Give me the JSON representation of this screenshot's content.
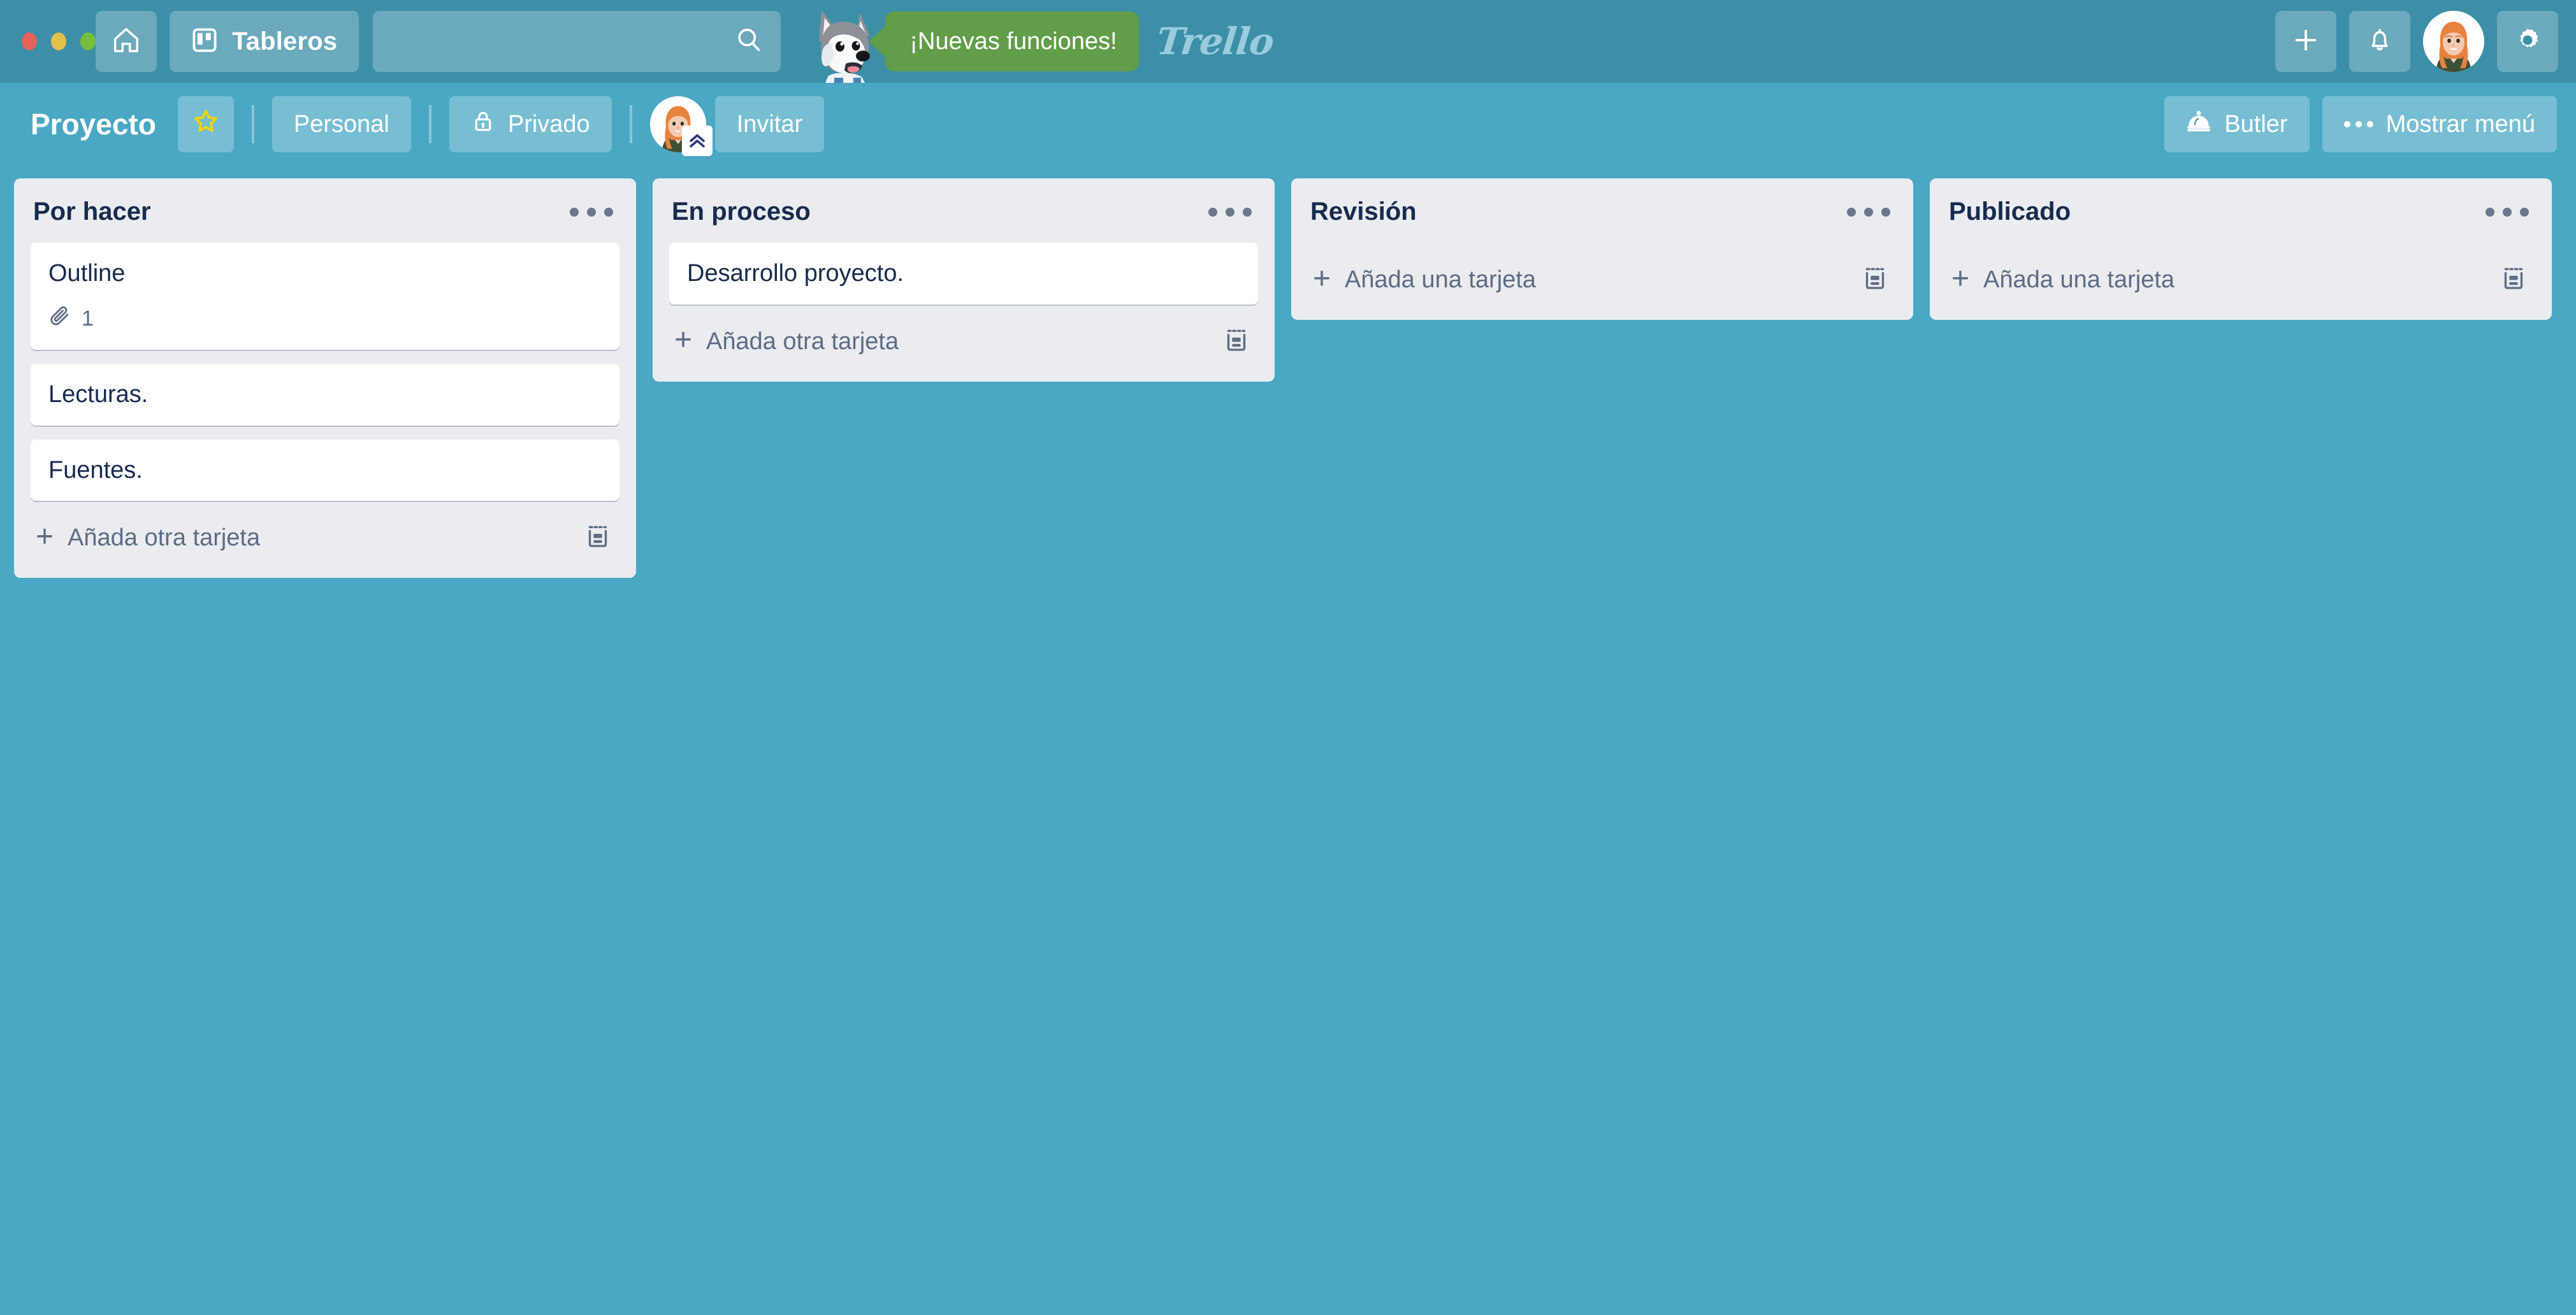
{
  "colors": {
    "top_header_bg": "#3d8fa8",
    "board_bg": "#4aa8c4",
    "list_bg": "#ebecf0",
    "card_bg": "#ffffff",
    "text_dark": "#172b4d",
    "text_muted": "#5e6c84",
    "promo_green": "#629d49",
    "star_yellow": "#f2d600",
    "traffic_red": "#e8615a",
    "traffic_yellow": "#e2c14a",
    "traffic_green": "#76bf3d"
  },
  "window": {
    "traffic_lights": [
      "close-button",
      "minimize-button",
      "maximize-button"
    ]
  },
  "top_header": {
    "home_icon": "home-icon",
    "boards_icon": "boards-icon",
    "boards_label": "Tableros",
    "search": {
      "value": "",
      "placeholder": "",
      "icon": "search-icon"
    },
    "mascot": "husky-mascot",
    "promo_label": "¡Nuevas funciones!",
    "logo_text": "Trello",
    "add_icon": "plus-icon",
    "notifications_icon": "bell-icon",
    "avatar": "user-avatar",
    "settings_icon": "gear-icon"
  },
  "board_header": {
    "title": "Proyecto",
    "star_icon": "star-icon",
    "visibility_team": "Personal",
    "privacy_icon": "lock-icon",
    "privacy_label": "Privado",
    "member_avatar": "member-avatar",
    "member_badge_icon": "chevron-up-double-icon",
    "invite_label": "Invitar",
    "butler_icon": "butler-bell-icon",
    "butler_label": "Butler",
    "menu_dots_icon": "dots-horizontal-icon",
    "menu_label": "Mostrar menú"
  },
  "lists": [
    {
      "title": "Por hacer",
      "menu_icon": "dots-horizontal-icon",
      "cards": [
        {
          "title": "Outline",
          "badges": [
            {
              "type": "attachment",
              "icon": "paperclip-icon",
              "count": "1"
            }
          ]
        },
        {
          "title": "Lecturas.",
          "badges": []
        },
        {
          "title": "Fuentes.",
          "badges": []
        }
      ],
      "add_card_label": "Añada otra tarjeta",
      "add_card_icon": "plus-icon",
      "template_icon": "card-template-icon"
    },
    {
      "title": "En proceso",
      "menu_icon": "dots-horizontal-icon",
      "cards": [
        {
          "title": "Desarrollo proyecto.",
          "badges": []
        }
      ],
      "add_card_label": "Añada otra tarjeta",
      "add_card_icon": "plus-icon",
      "template_icon": "card-template-icon"
    },
    {
      "title": "Revisión",
      "menu_icon": "dots-horizontal-icon",
      "cards": [],
      "add_card_label": "Añada una tarjeta",
      "add_card_icon": "plus-icon",
      "template_icon": "card-template-icon"
    },
    {
      "title": "Publicado",
      "menu_icon": "dots-horizontal-icon",
      "cards": [],
      "add_card_label": "Añada una tarjeta",
      "add_card_icon": "plus-icon",
      "template_icon": "card-template-icon"
    }
  ]
}
